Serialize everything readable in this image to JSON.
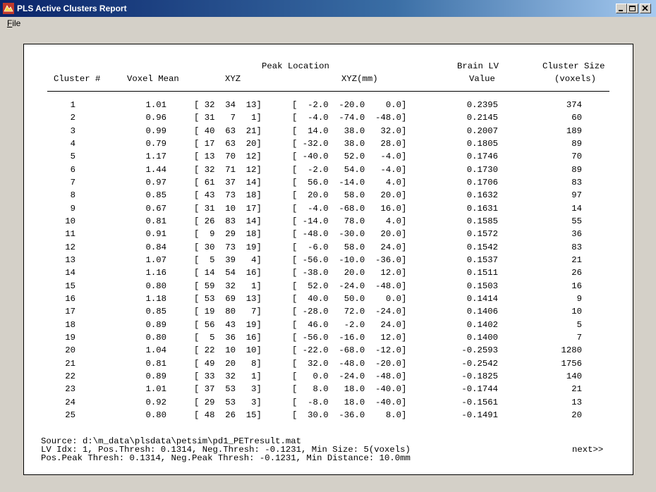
{
  "window": {
    "title": "PLS Active Clusters Report",
    "minimize_glyph": "minimize-icon",
    "maximize_glyph": "maximize-icon",
    "close_glyph": "close-icon"
  },
  "menu": {
    "file_label_first": "F",
    "file_label_rest": "ile"
  },
  "table": {
    "headers": {
      "peak_location": "Peak Location",
      "brain_lv": "Brain LV",
      "cluster_size": "Cluster Size",
      "cluster_num": "Cluster #",
      "voxel_mean": "Voxel Mean",
      "xyz": "XYZ",
      "xyz_mm": "XYZ(mm)",
      "value": "Value",
      "voxels": "(voxels)"
    },
    "rows": [
      {
        "cluster": "1",
        "voxel_mean": "1.01",
        "xyz": "[ 32  34  13]",
        "xyz_mm": "[  -2.0  -20.0    0.0]",
        "brain_lv": "0.2395",
        "size": "374"
      },
      {
        "cluster": "2",
        "voxel_mean": "0.96",
        "xyz": "[ 31   7   1]",
        "xyz_mm": "[  -4.0  -74.0  -48.0]",
        "brain_lv": "0.2145",
        "size": "60"
      },
      {
        "cluster": "3",
        "voxel_mean": "0.99",
        "xyz": "[ 40  63  21]",
        "xyz_mm": "[  14.0   38.0   32.0]",
        "brain_lv": "0.2007",
        "size": "189"
      },
      {
        "cluster": "4",
        "voxel_mean": "0.79",
        "xyz": "[ 17  63  20]",
        "xyz_mm": "[ -32.0   38.0   28.0]",
        "brain_lv": "0.1805",
        "size": "89"
      },
      {
        "cluster": "5",
        "voxel_mean": "1.17",
        "xyz": "[ 13  70  12]",
        "xyz_mm": "[ -40.0   52.0   -4.0]",
        "brain_lv": "0.1746",
        "size": "70"
      },
      {
        "cluster": "6",
        "voxel_mean": "1.44",
        "xyz": "[ 32  71  12]",
        "xyz_mm": "[  -2.0   54.0   -4.0]",
        "brain_lv": "0.1730",
        "size": "89"
      },
      {
        "cluster": "7",
        "voxel_mean": "0.97",
        "xyz": "[ 61  37  14]",
        "xyz_mm": "[  56.0  -14.0    4.0]",
        "brain_lv": "0.1706",
        "size": "83"
      },
      {
        "cluster": "8",
        "voxel_mean": "0.85",
        "xyz": "[ 43  73  18]",
        "xyz_mm": "[  20.0   58.0   20.0]",
        "brain_lv": "0.1632",
        "size": "97"
      },
      {
        "cluster": "9",
        "voxel_mean": "0.67",
        "xyz": "[ 31  10  17]",
        "xyz_mm": "[  -4.0  -68.0   16.0]",
        "brain_lv": "0.1631",
        "size": "14"
      },
      {
        "cluster": "10",
        "voxel_mean": "0.81",
        "xyz": "[ 26  83  14]",
        "xyz_mm": "[ -14.0   78.0    4.0]",
        "brain_lv": "0.1585",
        "size": "55"
      },
      {
        "cluster": "11",
        "voxel_mean": "0.91",
        "xyz": "[  9  29  18]",
        "xyz_mm": "[ -48.0  -30.0   20.0]",
        "brain_lv": "0.1572",
        "size": "36"
      },
      {
        "cluster": "12",
        "voxel_mean": "0.84",
        "xyz": "[ 30  73  19]",
        "xyz_mm": "[  -6.0   58.0   24.0]",
        "brain_lv": "0.1542",
        "size": "83"
      },
      {
        "cluster": "13",
        "voxel_mean": "1.07",
        "xyz": "[  5  39   4]",
        "xyz_mm": "[ -56.0  -10.0  -36.0]",
        "brain_lv": "0.1537",
        "size": "21"
      },
      {
        "cluster": "14",
        "voxel_mean": "1.16",
        "xyz": "[ 14  54  16]",
        "xyz_mm": "[ -38.0   20.0   12.0]",
        "brain_lv": "0.1511",
        "size": "26"
      },
      {
        "cluster": "15",
        "voxel_mean": "0.80",
        "xyz": "[ 59  32   1]",
        "xyz_mm": "[  52.0  -24.0  -48.0]",
        "brain_lv": "0.1503",
        "size": "16"
      },
      {
        "cluster": "16",
        "voxel_mean": "1.18",
        "xyz": "[ 53  69  13]",
        "xyz_mm": "[  40.0   50.0    0.0]",
        "brain_lv": "0.1414",
        "size": "9"
      },
      {
        "cluster": "17",
        "voxel_mean": "0.85",
        "xyz": "[ 19  80   7]",
        "xyz_mm": "[ -28.0   72.0  -24.0]",
        "brain_lv": "0.1406",
        "size": "10"
      },
      {
        "cluster": "18",
        "voxel_mean": "0.89",
        "xyz": "[ 56  43  19]",
        "xyz_mm": "[  46.0   -2.0   24.0]",
        "brain_lv": "0.1402",
        "size": "5"
      },
      {
        "cluster": "19",
        "voxel_mean": "0.80",
        "xyz": "[  5  36  16]",
        "xyz_mm": "[ -56.0  -16.0   12.0]",
        "brain_lv": "0.1400",
        "size": "7"
      },
      {
        "cluster": "20",
        "voxel_mean": "1.04",
        "xyz": "[ 22  10  10]",
        "xyz_mm": "[ -22.0  -68.0  -12.0]",
        "brain_lv": "-0.2593",
        "size": "1280"
      },
      {
        "cluster": "21",
        "voxel_mean": "0.81",
        "xyz": "[ 49  20   8]",
        "xyz_mm": "[  32.0  -48.0  -20.0]",
        "brain_lv": "-0.2542",
        "size": "1756"
      },
      {
        "cluster": "22",
        "voxel_mean": "0.89",
        "xyz": "[ 33  32   1]",
        "xyz_mm": "[   0.0  -24.0  -48.0]",
        "brain_lv": "-0.1825",
        "size": "140"
      },
      {
        "cluster": "23",
        "voxel_mean": "1.01",
        "xyz": "[ 37  53   3]",
        "xyz_mm": "[   8.0   18.0  -40.0]",
        "brain_lv": "-0.1744",
        "size": "21"
      },
      {
        "cluster": "24",
        "voxel_mean": "0.92",
        "xyz": "[ 29  53   3]",
        "xyz_mm": "[  -8.0   18.0  -40.0]",
        "brain_lv": "-0.1561",
        "size": "13"
      },
      {
        "cluster": "25",
        "voxel_mean": "0.80",
        "xyz": "[ 48  26  15]",
        "xyz_mm": "[  30.0  -36.0    8.0]",
        "brain_lv": "-0.1491",
        "size": "20"
      }
    ]
  },
  "footer": {
    "source": "Source: d:\\m_data\\plsdata\\petsim\\pd1_PETresult.mat",
    "thresh_line": "LV Idx: 1, Pos.Thresh: 0.1314, Neg.Thresh: -0.1231, Min Size: 5(voxels)",
    "peak_line": "Pos.Peak Thresh: 0.1314, Neg.Peak Thresh: -0.1231, Min Distance: 10.0mm",
    "next_link": "next>>"
  }
}
